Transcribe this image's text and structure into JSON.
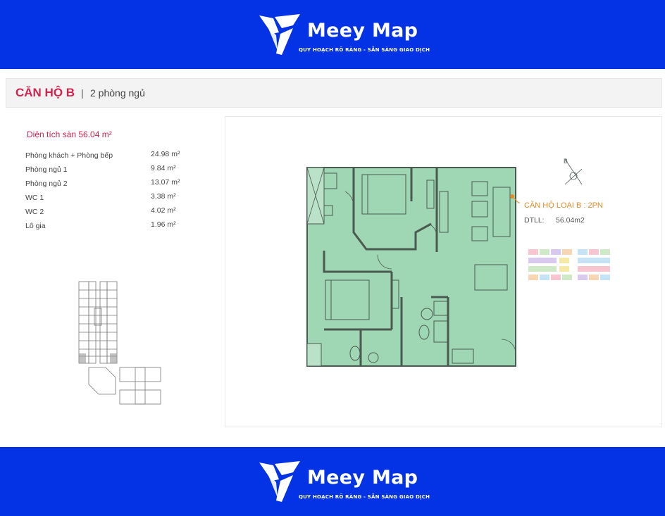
{
  "brand": {
    "name": "Meey Map",
    "tagline": "QUY HOẠCH RÕ RÀNG - SẴN SÀNG GIAO DỊCH",
    "color": "#0433e6"
  },
  "header": {
    "title": "CĂN HỘ B",
    "separator": "|",
    "subtitle": "2 phòng ngủ"
  },
  "area": {
    "heading": "Diện tích sàn 56.04 m²",
    "rooms": [
      {
        "name": "Phòng khách + Phòng bếp",
        "value": "24.98 m²"
      },
      {
        "name": "Phòng ngủ 1",
        "value": "9.84 m²"
      },
      {
        "name": "Phòng ngủ 2",
        "value": "13.07 m²"
      },
      {
        "name": "WC 1",
        "value": "3.38 m²"
      },
      {
        "name": "WC 2",
        "value": "4.02 m²"
      },
      {
        "name": "Lô gia",
        "value": "1.96 m²"
      }
    ]
  },
  "floorplan": {
    "label": "CĂN HỘ LOẠI B : 2PN",
    "dtll_key": "DTLL:",
    "dtll_value": "56.04m2",
    "compass_letter": "B",
    "fill_color": "#9fd6b4",
    "accent_color": "#e08b2a"
  }
}
